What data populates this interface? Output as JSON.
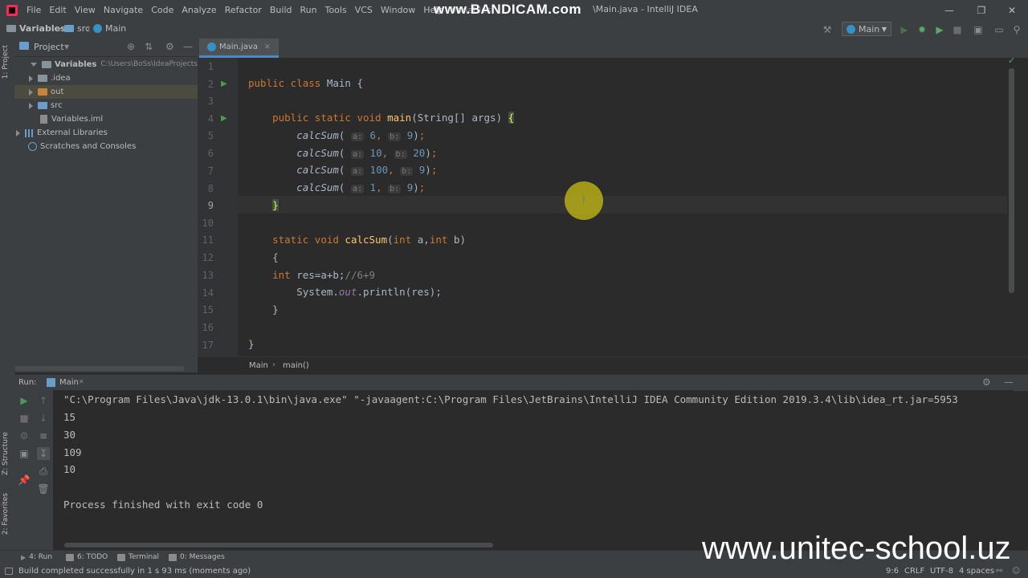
{
  "menu": {
    "items": [
      "File",
      "Edit",
      "View",
      "Navigate",
      "Code",
      "Analyze",
      "Refactor",
      "Build",
      "Run",
      "Tools",
      "VCS",
      "Window",
      "Help"
    ],
    "window_title": "Variables",
    "bandicam": "www.BANDICAM.com",
    "title_rest": "\\Main.java - IntelliJ IDEA"
  },
  "navbar": {
    "crumbs": [
      "Variables",
      "src",
      "Main"
    ],
    "run_config": "Main"
  },
  "project": {
    "header": "Project",
    "root_name": "Variables",
    "root_path": "C:\\Users\\BoSs\\IdeaProjects\\Variab",
    "items": [
      ".idea",
      "out",
      "src",
      "Variables.iml",
      "External Libraries",
      "Scratches and Consoles"
    ]
  },
  "left_strip": {
    "project_tab": "1: Project",
    "structure_tab": "Z: Structure",
    "favorites_tab": "2: Favorites"
  },
  "editor": {
    "tab_label": "Main.java",
    "line_numbers": [
      "1",
      "2",
      "3",
      "4",
      "5",
      "6",
      "7",
      "8",
      "9",
      "10",
      "11",
      "12",
      "13",
      "14",
      "15",
      "16",
      "17"
    ],
    "l2": {
      "kw": "public class ",
      "name": "Main {"
    },
    "l4": {
      "kw": "public static void ",
      "fn": "main",
      "rest": "(String[] args) ",
      "brace": "{"
    },
    "calls": [
      {
        "fn": "calcSum",
        "ha": "a:",
        "a": "6",
        "hb": "b:",
        "b": "9"
      },
      {
        "fn": "calcSum",
        "ha": "a:",
        "a": "10",
        "hb": "b:",
        "b": "20"
      },
      {
        "fn": "calcSum",
        "ha": "a:",
        "a": "100",
        "hb": "b:",
        "b": "9"
      },
      {
        "fn": "calcSum",
        "ha": "a:",
        "a": "1",
        "hb": "b:",
        "b": "9"
      }
    ],
    "l9": "}",
    "l11": {
      "kw1": "static void ",
      "fn": "calcSum",
      "p1": "(",
      "kw2": "int ",
      "a": "a,",
      "kw3": "int ",
      "b": "b)"
    },
    "l12": "{",
    "l13": {
      "kw": "int ",
      "expr": "res=a+b;",
      "comment": "//6+9"
    },
    "l14": {
      "sys": "System.",
      "out": "out",
      "rest": ".println(res);"
    },
    "l15": "}",
    "l17": "}",
    "crumbs": [
      "Main",
      "main()"
    ]
  },
  "run": {
    "label": "Run:",
    "tab": "Main",
    "output": [
      "\"C:\\Program Files\\Java\\jdk-13.0.1\\bin\\java.exe\" \"-javaagent:C:\\Program Files\\JetBrains\\IntelliJ IDEA Community Edition 2019.3.4\\lib\\idea_rt.jar=5953",
      "15",
      "30",
      "109",
      "10",
      "",
      "Process finished with exit code 0"
    ]
  },
  "bottom_tabs": [
    "4: Run",
    "6: TODO",
    "Terminal",
    "0: Messages"
  ],
  "status": {
    "message": "Build completed successfully in 1 s 93 ms (moments ago)",
    "position": "9:6",
    "line_sep": "CRLF",
    "encoding": "UTF-8",
    "indent": "4 spaces"
  },
  "watermark": "www.unitec-school.uz"
}
